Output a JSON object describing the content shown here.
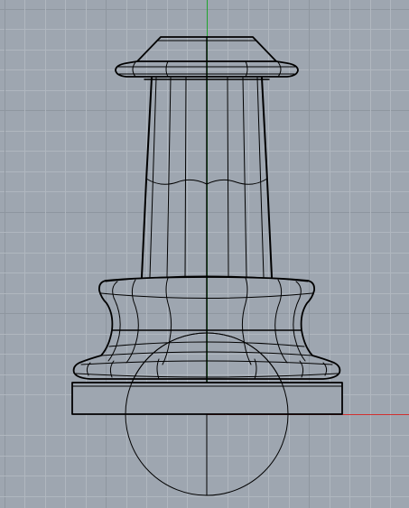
{
  "viewport": {
    "background": "#9ea6b0",
    "grid_minor_color": "#b0b7bf",
    "grid_major_color": "#8e969f",
    "y_axis_color": "#1fa52d",
    "x_axis_color": "#d12f2f",
    "wireframe_color": "#000000"
  },
  "objects": [
    {
      "name": "column-cap",
      "type": "surface"
    },
    {
      "name": "column-shaft",
      "type": "surface"
    },
    {
      "name": "column-base-molding",
      "type": "surface"
    },
    {
      "name": "plinth-block",
      "type": "box"
    },
    {
      "name": "sphere",
      "type": "sphere"
    }
  ]
}
